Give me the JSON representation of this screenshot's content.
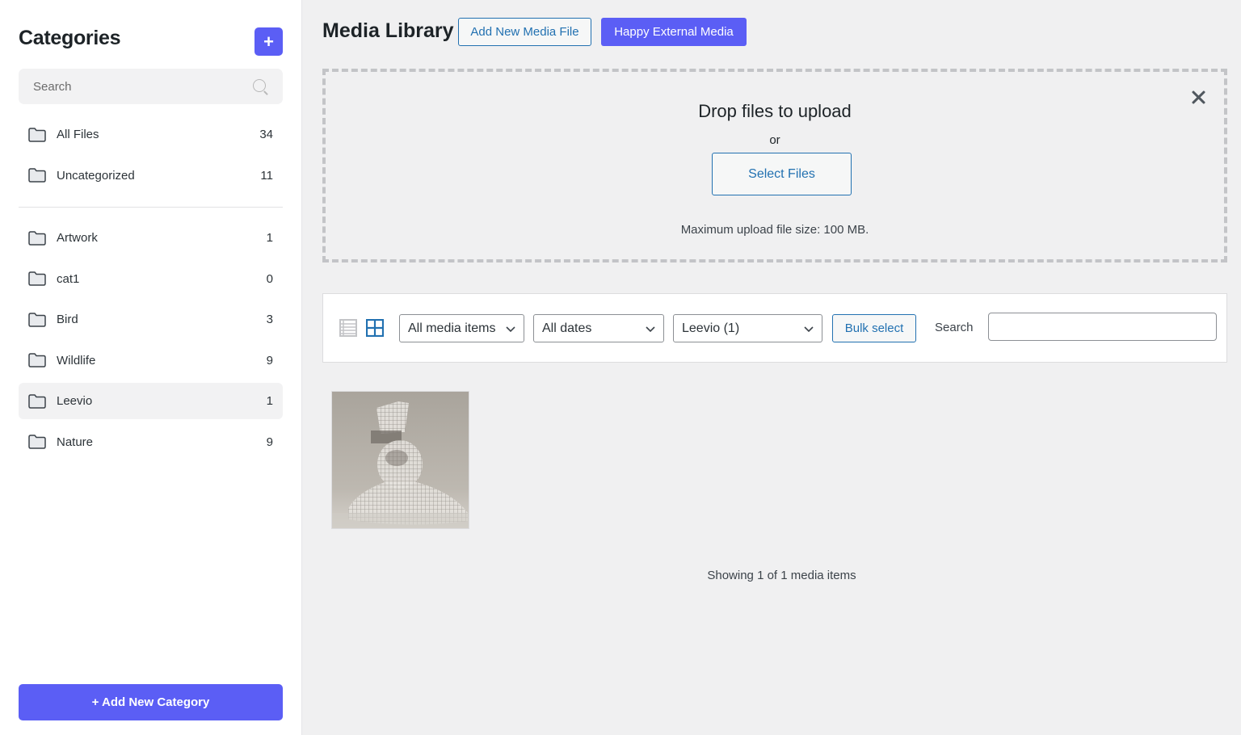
{
  "sidebar": {
    "title": "Categories",
    "add_icon": "plus-icon",
    "search_placeholder": "Search",
    "primary_items": [
      {
        "label": "All Files",
        "count": "34"
      },
      {
        "label": "Uncategorized",
        "count": "11"
      }
    ],
    "items": [
      {
        "label": "Artwork",
        "count": "1"
      },
      {
        "label": "cat1",
        "count": "0"
      },
      {
        "label": "Bird",
        "count": "3"
      },
      {
        "label": "Wildlife",
        "count": "9"
      },
      {
        "label": "Leevio",
        "count": "1",
        "active": true
      },
      {
        "label": "Nature",
        "count": "9"
      }
    ],
    "add_category_label": "+ Add New Category"
  },
  "header": {
    "title": "Media Library",
    "add_new_label": "Add New Media File",
    "external_label": "Happy External Media"
  },
  "dropzone": {
    "title": "Drop files to upload",
    "or": "or",
    "select_label": "Select Files",
    "max_size": "Maximum upload file size: 100 MB."
  },
  "toolbar": {
    "type_filter": "All media items",
    "date_filter": "All dates",
    "category_filter": "Leevio (1)",
    "bulk_label": "Bulk select",
    "search_label": "Search",
    "search_value": ""
  },
  "media": {
    "items": [
      {
        "alt": "wireframe sculpture bust"
      }
    ],
    "status": "Showing 1 of 1 media items"
  },
  "colors": {
    "accent": "#5b5ef5",
    "link": "#2271b1",
    "background": "#f0f0f1"
  }
}
